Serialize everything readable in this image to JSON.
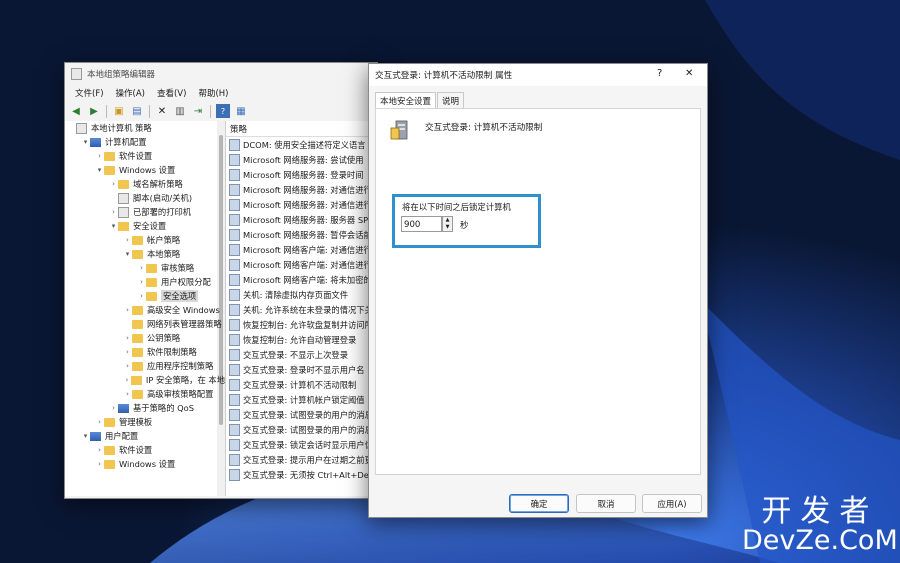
{
  "mmc": {
    "title": "本地组策略编辑器",
    "menu": [
      "文件(F)",
      "操作(A)",
      "查看(V)",
      "帮助(H)"
    ],
    "tree": [
      {
        "label": "本地计算机 策略",
        "level": 0,
        "exp": "",
        "icon": "doc"
      },
      {
        "label": "计算机配置",
        "level": 1,
        "exp": "▾",
        "icon": "pc"
      },
      {
        "label": "软件设置",
        "level": 2,
        "exp": "›",
        "icon": "folder"
      },
      {
        "label": "Windows 设置",
        "level": 2,
        "exp": "▾",
        "icon": "folder"
      },
      {
        "label": "域名解析策略",
        "level": 3,
        "exp": "›",
        "icon": "folder"
      },
      {
        "label": "脚本(启动/关机)",
        "level": 3,
        "exp": "",
        "icon": "doc"
      },
      {
        "label": "已部署的打印机",
        "level": 3,
        "exp": "›",
        "icon": "doc"
      },
      {
        "label": "安全设置",
        "level": 3,
        "exp": "▾",
        "icon": "lock"
      },
      {
        "label": "帐户策略",
        "level": 4,
        "exp": "›",
        "icon": "folder"
      },
      {
        "label": "本地策略",
        "level": 4,
        "exp": "▾",
        "icon": "folder"
      },
      {
        "label": "审核策略",
        "level": 5,
        "exp": "›",
        "icon": "folder"
      },
      {
        "label": "用户权限分配",
        "level": 5,
        "exp": "›",
        "icon": "folder"
      },
      {
        "label": "安全选项",
        "level": 5,
        "exp": "›",
        "icon": "folder",
        "selected": true
      },
      {
        "label": "高级安全 Windows",
        "level": 4,
        "exp": "›",
        "icon": "folder"
      },
      {
        "label": "网络列表管理器策略",
        "level": 4,
        "exp": "",
        "icon": "folder"
      },
      {
        "label": "公钥策略",
        "level": 4,
        "exp": "›",
        "icon": "folder"
      },
      {
        "label": "软件限制策略",
        "level": 4,
        "exp": "›",
        "icon": "folder"
      },
      {
        "label": "应用程序控制策略",
        "level": 4,
        "exp": "›",
        "icon": "folder"
      },
      {
        "label": "IP 安全策略，在 本地",
        "level": 4,
        "exp": "›",
        "icon": "lock"
      },
      {
        "label": "高级审核策略配置",
        "level": 4,
        "exp": "›",
        "icon": "folder"
      },
      {
        "label": "基于策略的 QoS",
        "level": 3,
        "exp": "›",
        "icon": "pc"
      },
      {
        "label": "管理模板",
        "level": 2,
        "exp": "›",
        "icon": "folder"
      },
      {
        "label": "用户配置",
        "level": 1,
        "exp": "▾",
        "icon": "pc"
      },
      {
        "label": "软件设置",
        "level": 2,
        "exp": "›",
        "icon": "folder"
      },
      {
        "label": "Windows 设置",
        "level": 2,
        "exp": "›",
        "icon": "folder"
      }
    ],
    "list_header": "策略",
    "list": [
      "DCOM: 使用安全描述符定义语言",
      "Microsoft 网络服务器: 尝试使用",
      "Microsoft 网络服务器: 登录时间",
      "Microsoft 网络服务器: 对通信进行",
      "Microsoft 网络服务器: 对通信进行",
      "Microsoft 网络服务器: 服务器 SP",
      "Microsoft 网络服务器: 暂停会话前",
      "Microsoft 网络客户端: 对通信进行",
      "Microsoft 网络客户端: 对通信进行",
      "Microsoft 网络客户端: 将未加密的",
      "关机: 清除虚拟内存页面文件",
      "关机: 允许系统在未登录的情况下关",
      "恢复控制台: 允许软盘复制并访问所",
      "恢复控制台: 允许自动管理登录",
      "交互式登录: 不显示上次登录",
      "交互式登录: 登录时不显示用户名",
      "交互式登录: 计算机不活动限制",
      "交互式登录: 计算机帐户锁定阈值",
      "交互式登录: 试图登录的用户的消息",
      "交互式登录: 试图登录的用户的消息",
      "交互式登录: 锁定会话时显示用户信",
      "交互式登录: 提示用户在过期之前更",
      "交互式登录: 无须按 Ctrl+Alt+Del"
    ]
  },
  "dialog": {
    "title": "交互式登录: 计算机不活动限制 属性",
    "help": "?",
    "close": "✕",
    "tabs": [
      "本地安全设置",
      "说明"
    ],
    "policy_title": "交互式登录: 计算机不活动限制",
    "lock_label": "将在以下时间之后锁定计算机",
    "value": "900",
    "unit": "秒",
    "buttons": {
      "ok": "确定",
      "cancel": "取消",
      "apply": "应用(A)"
    }
  },
  "watermark": {
    "line1": "开发者",
    "line2": "DevZe.CoM"
  }
}
